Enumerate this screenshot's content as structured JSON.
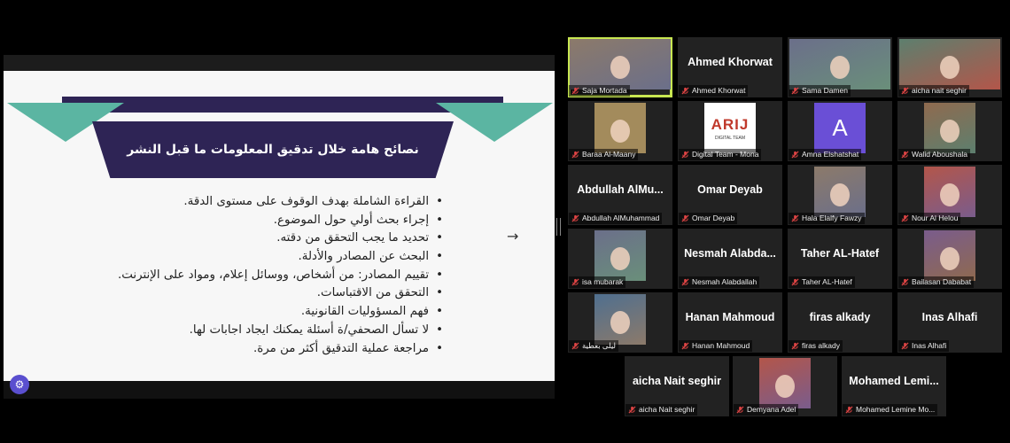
{
  "slide": {
    "title": "نصائح هامة خلال تدقيق المعلومات ما قبل النشر",
    "bullets": [
      "القراءة الشاملة بهدف الوقوف على مستوى الدقة.",
      "إجراء بحث أولي حول الموضوع.",
      "تحديد ما يجب التحقق من دقته.",
      "البحث عن المصادر والأدلة.",
      "تقييم المصادر: من أشخاص، ووسائل إعلام، ومواد على الإنترنت.",
      "التحقق من الاقتباسات.",
      "فهم المسؤوليات القانونية.",
      "لا تسأل الصحفي/ة أسئلة يمكنك ايجاد اجابات لها.",
      "مراجعة عملية التدقيق أكثر من مرة."
    ]
  },
  "colors": {
    "navy": "#2e2455",
    "teal": "#5bb5a2",
    "active_speaker": "#c7e651",
    "tile_bg": "#222222"
  },
  "participants": [
    {
      "label": "Saja Mortada",
      "tile_text": "",
      "kind": "video",
      "active": true
    },
    {
      "label": "Ahmed Khorwat",
      "tile_text": "Ahmed Khorwat",
      "kind": "name"
    },
    {
      "label": "Sama Damen",
      "tile_text": "",
      "kind": "video"
    },
    {
      "label": "aicha nait seghir",
      "tile_text": "",
      "kind": "video"
    },
    {
      "label": "Baraa Al-Maany",
      "tile_text": "",
      "kind": "photo"
    },
    {
      "label": "Digital Team - Mona",
      "tile_text": "ARIJ",
      "tile_subtext": "DIGITAL TEAM",
      "kind": "logo"
    },
    {
      "label": "Amna Elshatshat",
      "tile_text": "A",
      "kind": "letter"
    },
    {
      "label": "Walid Aboushala",
      "tile_text": "",
      "kind": "photo"
    },
    {
      "label": "Abdullah AlMuhammad",
      "tile_text": "Abdullah  AlMu...",
      "kind": "name"
    },
    {
      "label": "Omar Deyab",
      "tile_text": "Omar Deyab",
      "kind": "name"
    },
    {
      "label": "Hala Elalfy Fawzy",
      "tile_text": "",
      "kind": "photo"
    },
    {
      "label": "Nour Al Helou",
      "tile_text": "",
      "kind": "photo"
    },
    {
      "label": "isa mubarak",
      "tile_text": "",
      "kind": "photo"
    },
    {
      "label": "Nesmah Alabdallah",
      "tile_text": "Nesmah  Alabda...",
      "kind": "name"
    },
    {
      "label": "Taher AL-Hatef",
      "tile_text": "Taher AL-Hatef",
      "kind": "name"
    },
    {
      "label": "Bailasan Dababat",
      "tile_text": "",
      "kind": "photo"
    },
    {
      "label": "ليلى بعطية",
      "tile_text": "",
      "kind": "photo"
    },
    {
      "label": "Hanan Mahmoud",
      "tile_text": "Hanan Mahmoud",
      "kind": "name"
    },
    {
      "label": "firas alkady",
      "tile_text": "firas alkady",
      "kind": "name"
    },
    {
      "label": "Inas Alhafi",
      "tile_text": "Inas Alhafi",
      "kind": "name"
    },
    {
      "label": "aicha Nait seghir",
      "tile_text": "aicha Nait seghir",
      "kind": "name"
    },
    {
      "label": "Demyana Adel",
      "tile_text": "",
      "kind": "photo"
    },
    {
      "label": "Mohamed Lemine Mo...",
      "tile_text": "Mohamed  Lemi...",
      "kind": "name"
    }
  ]
}
